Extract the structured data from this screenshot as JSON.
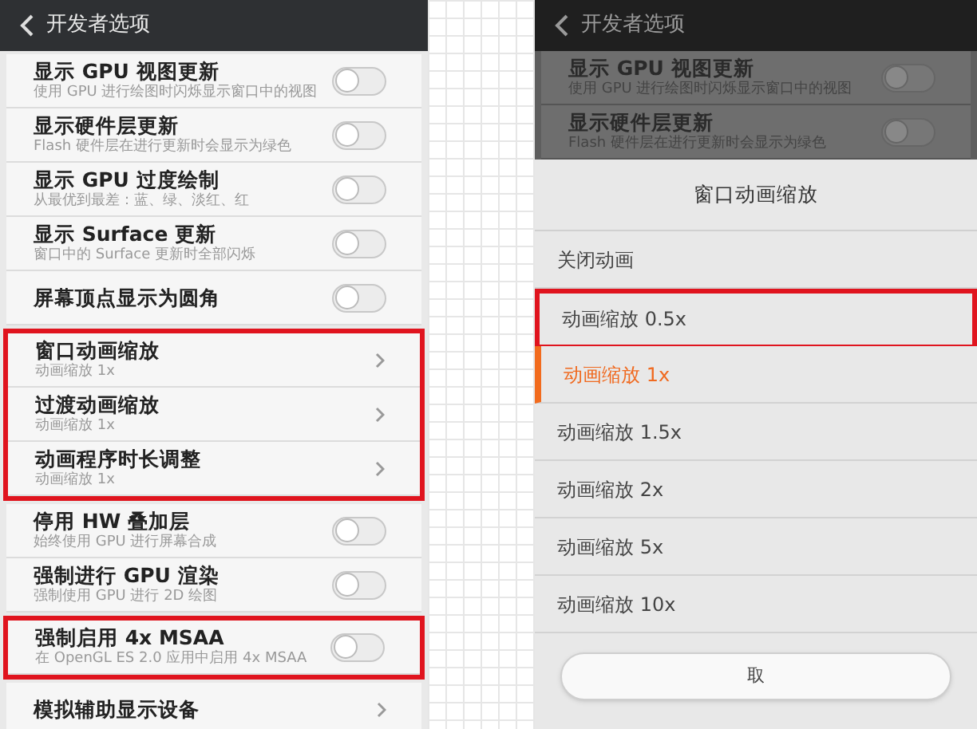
{
  "left_screen": {
    "header": {
      "title": "开发者选项"
    },
    "groups": [
      {
        "highlighted": false,
        "items": [
          {
            "kind": "toggle",
            "title": "显示 GPU 视图更新",
            "subtitle": "使用 GPU 进行绘图时闪烁显示窗口中的视图",
            "on": false
          },
          {
            "kind": "toggle",
            "title": "显示硬件层更新",
            "subtitle": "Flash 硬件层在进行更新时会显示为绿色",
            "on": false
          },
          {
            "kind": "toggle",
            "title": "显示 GPU 过度绘制",
            "subtitle": "从最优到最差：蓝、绿、淡红、红",
            "on": false
          },
          {
            "kind": "toggle",
            "title": "显示 Surface 更新",
            "subtitle": "窗口中的 Surface 更新时全部闪烁",
            "on": false
          },
          {
            "kind": "toggle",
            "title": "屏幕顶点显示为圆角",
            "on": false
          }
        ]
      },
      {
        "highlighted": true,
        "items": [
          {
            "kind": "link",
            "title": "窗口动画缩放",
            "subtitle": "动画缩放 1x"
          },
          {
            "kind": "link",
            "title": "过渡动画缩放",
            "subtitle": "动画缩放 1x"
          },
          {
            "kind": "link",
            "title": "动画程序时长调整",
            "subtitle": "动画缩放 1x"
          }
        ]
      },
      {
        "highlighted": false,
        "items": [
          {
            "kind": "toggle",
            "title": "停用 HW 叠加层",
            "subtitle": "始终使用 GPU 进行屏幕合成",
            "on": false
          },
          {
            "kind": "toggle",
            "title": "强制进行 GPU 渲染",
            "subtitle": "强制使用 GPU 进行 2D 绘图",
            "on": false
          }
        ]
      },
      {
        "highlighted": true,
        "items": [
          {
            "kind": "toggle",
            "title": "强制启用 4x MSAA",
            "subtitle": "在 OpenGL ES 2.0 应用中启用 4x MSAA",
            "on": false
          }
        ]
      },
      {
        "highlighted": false,
        "items": [
          {
            "kind": "link",
            "title": "模拟辅助显示设备"
          }
        ]
      }
    ]
  },
  "right_screen": {
    "header": {
      "title": "开发者选项"
    },
    "background_items": [
      {
        "title": "显示 GPU 视图更新",
        "subtitle": "使用 GPU 进行绘图时闪烁显示窗口中的视图",
        "on": false
      },
      {
        "title": "显示硬件层更新",
        "subtitle": "Flash 硬件层在进行更新时会显示为绿色",
        "on": false
      }
    ],
    "dialog": {
      "title": "窗口动画缩放",
      "options": [
        {
          "label": "关闭动画",
          "selected": false,
          "highlighted": false
        },
        {
          "label": "动画缩放 0.5x",
          "selected": false,
          "highlighted": true
        },
        {
          "label": "动画缩放 1x",
          "selected": true,
          "highlighted": false
        },
        {
          "label": "动画缩放 1.5x",
          "selected": false,
          "highlighted": false
        },
        {
          "label": "动画缩放 2x",
          "selected": false,
          "highlighted": false
        },
        {
          "label": "动画缩放 5x",
          "selected": false,
          "highlighted": false
        },
        {
          "label": "动画缩放 10x",
          "selected": false,
          "highlighted": false
        }
      ],
      "button": "取"
    }
  }
}
